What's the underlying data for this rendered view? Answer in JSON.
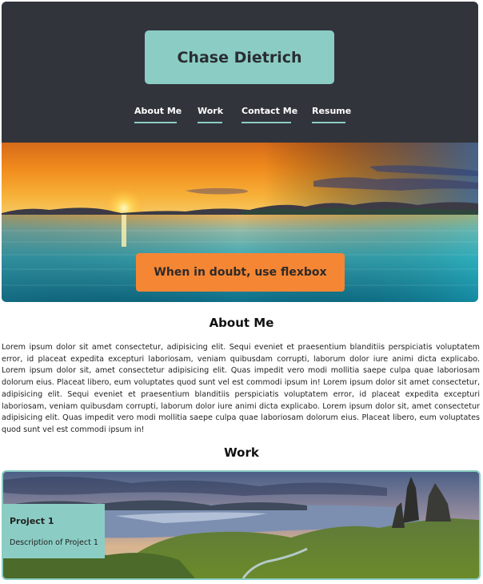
{
  "header": {
    "name": "Chase Dietrich",
    "nav": [
      {
        "label": "About Me"
      },
      {
        "label": "Work"
      },
      {
        "label": "Contact Me"
      },
      {
        "label": "Resume"
      }
    ]
  },
  "hero": {
    "tagline": "When in doubt, use flexbox"
  },
  "about": {
    "heading": "About Me",
    "body": "Lorem ipsum dolor sit amet consectetur, adipisicing elit. Sequi eveniet et praesentium blanditiis perspiciatis voluptatem error, id placeat expedita excepturi laboriosam, veniam quibusdam corrupti, laborum dolor iure animi dicta explicabo. Lorem ipsum dolor sit, amet consectetur adipisicing elit. Quas impedit vero modi mollitia saepe culpa quae laboriosam dolorum eius. Placeat libero, eum voluptates quod sunt vel est commodi ipsum in! Lorem ipsum dolor sit amet consectetur, adipisicing elit. Sequi eveniet et praesentium blanditiis perspiciatis voluptatem error, id placeat expedita excepturi laboriosam, veniam quibusdam corrupti, laborum dolor iure animi dicta explicabo. Lorem ipsum dolor sit, amet consectetur adipisicing elit. Quas impedit vero modi mollitia saepe culpa quae laboriosam dolorum eius. Placeat libero, eum voluptates quod sunt vel est commodi ipsum in!"
  },
  "work": {
    "heading": "Work",
    "projects": [
      {
        "title": "Project 1",
        "description": "Description of Project 1"
      }
    ]
  },
  "colors": {
    "header_bg": "#32343b",
    "accent_teal": "#8bcdc4",
    "accent_orange": "#f58634"
  }
}
